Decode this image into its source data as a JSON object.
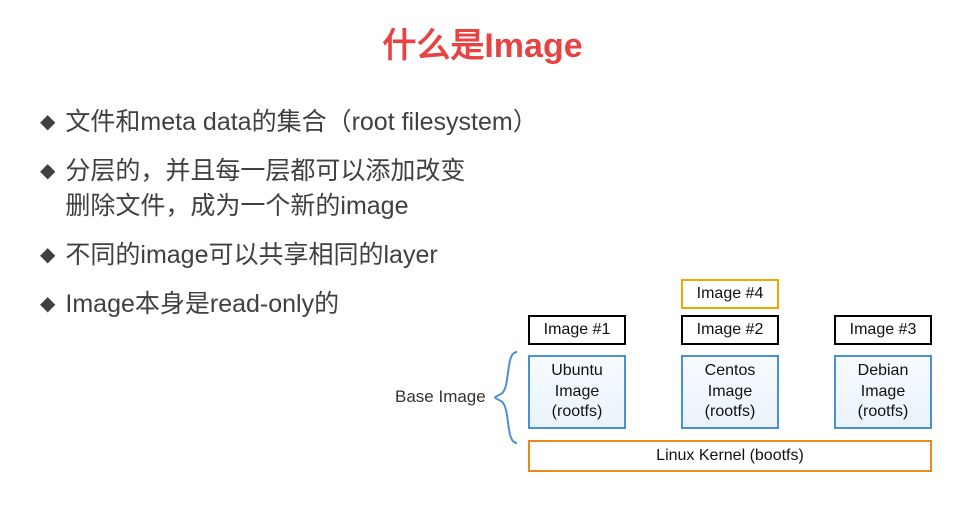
{
  "title": "什么是Image",
  "bullets": [
    "文件和meta data的集合（root filesystem）",
    "分层的，并且每一层都可以添加改变\n删除文件，成为一个新的image",
    "不同的image可以共享相同的layer",
    "Image本身是read-only的"
  ],
  "diagram": {
    "base_label": "Base Image",
    "image4_label": "Image #4",
    "columns": [
      {
        "top_label": "Image #1",
        "base_name": "Ubuntu\nImage\n(rootfs)"
      },
      {
        "top_label": "Image #2",
        "base_name": "Centos\nImage\n(rootfs)"
      },
      {
        "top_label": "Image #3",
        "base_name": "Debian\nImage\n(rootfs)"
      }
    ],
    "kernel_label": "Linux Kernel (bootfs)"
  },
  "colors": {
    "title": "#e84343",
    "image_border": "#000000",
    "image4_border": "#f0a800",
    "base_border": "#4a90d9",
    "kernel_border": "#e88b1a"
  }
}
